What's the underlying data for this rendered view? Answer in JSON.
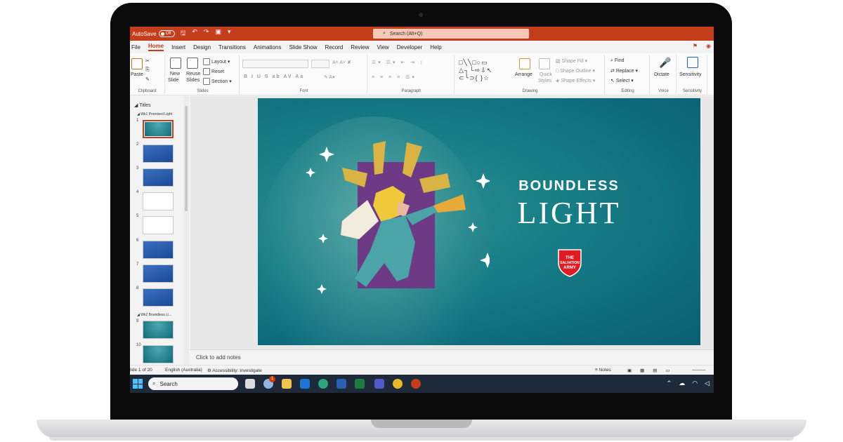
{
  "titlebar": {
    "autosave_label": "AutoSave",
    "autosave_state": "Off",
    "search_placeholder": "Search (Alt+Q)"
  },
  "menu": {
    "tabs": [
      "File",
      "Home",
      "Insert",
      "Design",
      "Transitions",
      "Animations",
      "Slide Show",
      "Record",
      "Review",
      "View",
      "Developer",
      "Help"
    ],
    "active_tab": "Home"
  },
  "ribbon": {
    "clipboard": {
      "paste": "Paste",
      "label": "Clipboard"
    },
    "slides": {
      "new_slide_1": "New",
      "new_slide_2": "Slide",
      "reuse_1": "Reuse",
      "reuse_2": "Slides",
      "layout": "Layout",
      "reset": "Reset",
      "section": "Section",
      "label": "Slides"
    },
    "font": {
      "label": "Font",
      "buttons": "B I U S ab AV Aa"
    },
    "paragraph": {
      "label": "Paragraph"
    },
    "drawing": {
      "arrange": "Arrange",
      "quick_styles_1": "Quick",
      "quick_styles_2": "Styles",
      "shape_fill": "Shape Fill",
      "shape_outline": "Shape Outline",
      "shape_effects": "Shape Effects",
      "label": "Drawing"
    },
    "editing": {
      "find": "Find",
      "replace": "Replace",
      "select": "Select",
      "label": "Editing"
    },
    "voice": {
      "dictate": "Dictate",
      "label": "Voice"
    },
    "sensitivity": {
      "button": "Sensitivity",
      "label": "Sensitivity"
    }
  },
  "thumbnails": {
    "section_root": "Titles",
    "section_1": "Wk1 Promised Light",
    "section_2": "Wk2 Boundless Li...",
    "slides": [
      {
        "num": "1",
        "style": "teal-angel",
        "selected": true
      },
      {
        "num": "2",
        "style": "blue"
      },
      {
        "num": "3",
        "style": "blue"
      },
      {
        "num": "4",
        "style": "white"
      },
      {
        "num": "5",
        "style": "white"
      },
      {
        "num": "6",
        "style": "blue"
      },
      {
        "num": "7",
        "style": "blue"
      },
      {
        "num": "8",
        "style": "blue"
      },
      {
        "num": "9",
        "style": "teal-angel"
      },
      {
        "num": "10",
        "style": "teal"
      }
    ]
  },
  "slide": {
    "title_line_1": "BOUNDLESS",
    "title_line_2": "LIGHT",
    "logo_text": "THE SALVATION ARMY",
    "background": "#137585",
    "logo_color": "#e21b23"
  },
  "notes_placeholder": "Click to add notes",
  "status": {
    "slide_count": "lide 1 of 20",
    "language": "English (Australia)",
    "accessibility": "Accessibility: Investigate",
    "notes_button": "Notes"
  },
  "taskbar": {
    "search": "Search",
    "badge": "1"
  },
  "colors": {
    "accent": "#c43e1c",
    "taskbar": "#1e2a3a"
  }
}
